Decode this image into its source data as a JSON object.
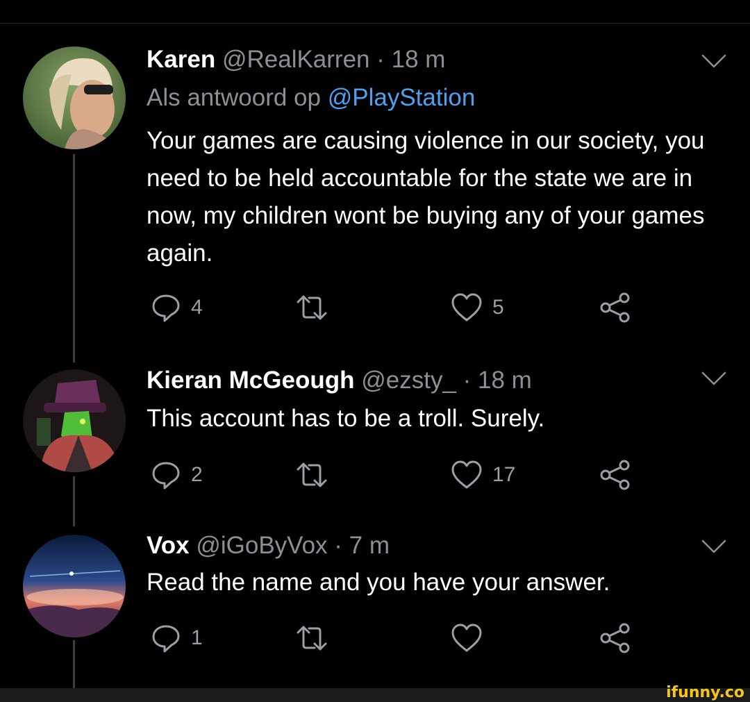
{
  "tweets": [
    {
      "name": "Karen",
      "handle": "@RealKarren",
      "time": "· 18 m",
      "reply_prefix": "Als antwoord op",
      "reply_mention": "@PlayStation",
      "text": "Your games are causing violence in our society, you need to be held accountable for the state we are in now, my children wont be buying any of your games again.",
      "reply_count": "4",
      "retweet_count": "",
      "like_count": "5"
    },
    {
      "name": "Kieran McGeough",
      "handle": "@ezsty_",
      "time": "· 18 m",
      "text": "This account has to be a troll. Surely.",
      "reply_count": "2",
      "retweet_count": "",
      "like_count": "17"
    },
    {
      "name": "Vox",
      "handle": "@iGoByVox",
      "time": "· 7 m",
      "text": "Read the name and you have your answer.",
      "reply_count": "1",
      "retweet_count": "",
      "like_count": ""
    }
  ],
  "icons": {
    "reply": "reply-icon",
    "retweet": "retweet-icon",
    "like": "heart-icon",
    "share": "share-icon",
    "more": "chevron-down-icon"
  },
  "colors": {
    "background": "#000000",
    "name": "#ffffff",
    "meta": "#8b9096",
    "mention": "#4aa3f0",
    "icon": "#9aa0a6",
    "watermark": "#f5c518"
  },
  "watermark": "ifunny.co"
}
